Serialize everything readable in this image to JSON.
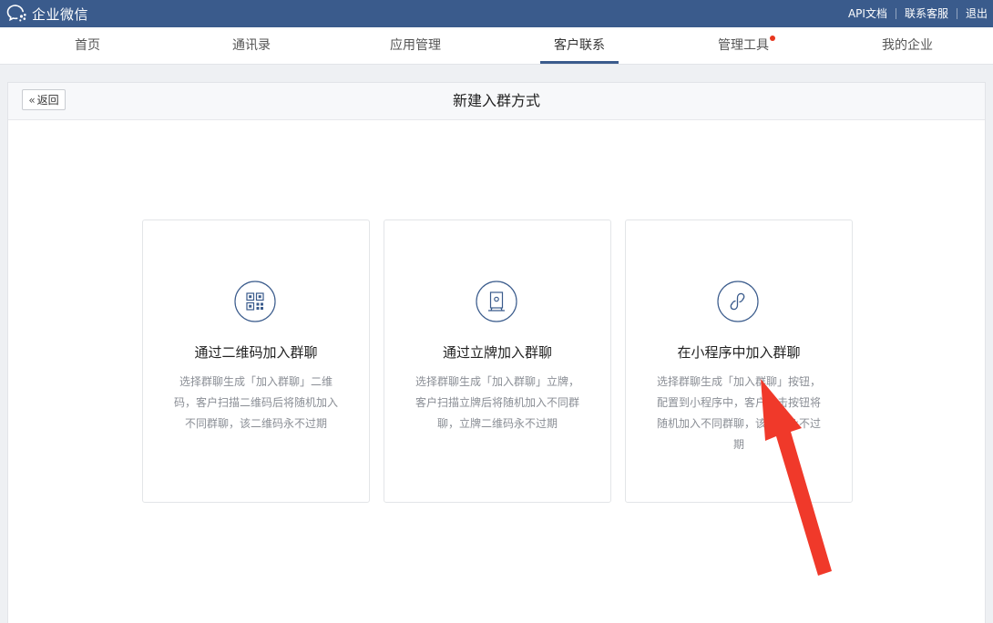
{
  "topbar": {
    "brand": "企业微信",
    "links": [
      "API文档",
      "联系客服",
      "退出"
    ],
    "background": "#3a5b8c"
  },
  "nav": {
    "items": [
      "首页",
      "通讯录",
      "应用管理",
      "客户联系",
      "管理工具",
      "我的企业"
    ],
    "active_index": 3,
    "badge_item_index": 4
  },
  "page": {
    "back_label": "返回",
    "title": "新建入群方式"
  },
  "cards": [
    {
      "icon": "qrcode-icon",
      "title": "通过二维码加入群聊",
      "desc": "选择群聊生成「加入群聊」二维码，客户扫描二维码后将随机加入不同群聊，该二维码永不过期"
    },
    {
      "icon": "standee-icon",
      "title": "通过立牌加入群聊",
      "desc": "选择群聊生成「加入群聊」立牌，客户扫描立牌后将随机加入不同群聊，立牌二维码永不过期"
    },
    {
      "icon": "mini-program-icon",
      "title": "在小程序中加入群聊",
      "desc": "选择群聊生成「加入群聊」按钮，配置到小程序中，客户点击按钮将随机加入不同群聊，该按钮永不过期"
    }
  ],
  "colors": {
    "accent": "#3a5b8c",
    "badge": "#e8361e",
    "arrow": "#f0392a"
  }
}
